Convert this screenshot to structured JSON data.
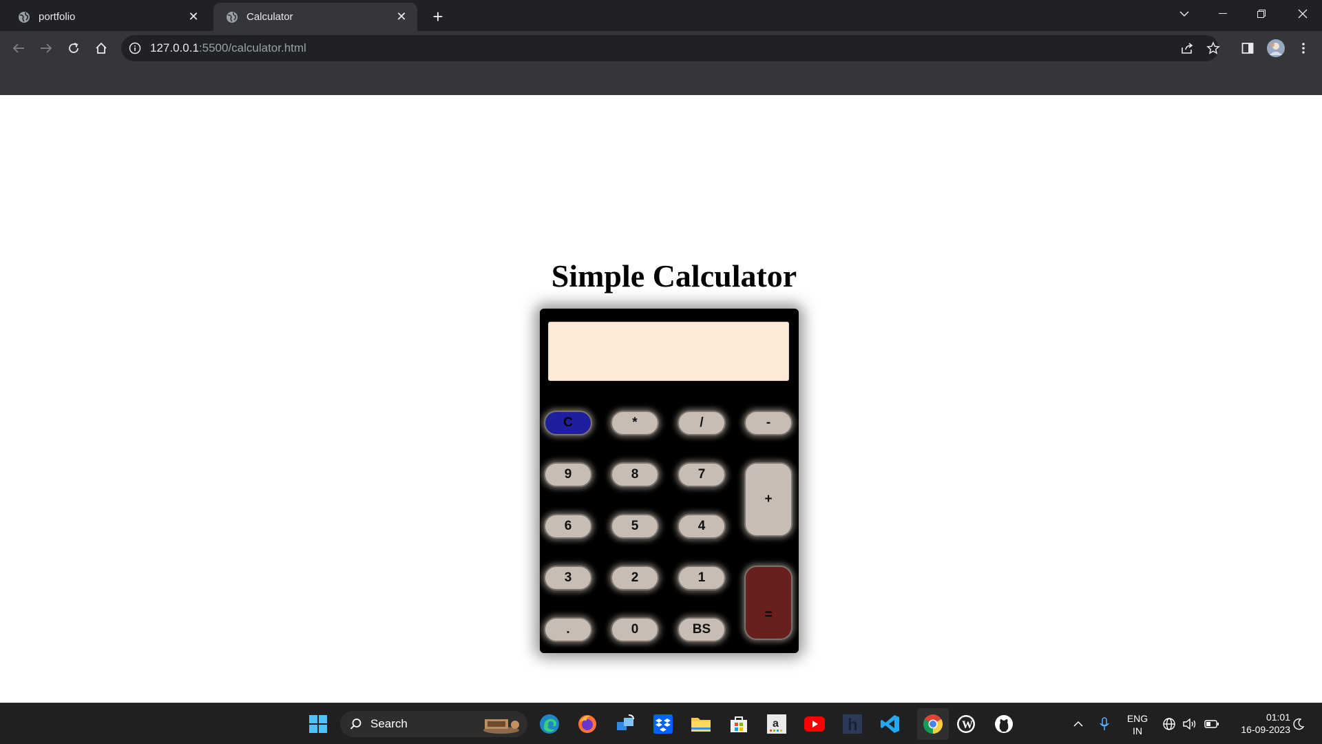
{
  "browser": {
    "tabs": [
      {
        "title": "portfolio",
        "active": false
      },
      {
        "title": "Calculator",
        "active": true
      }
    ],
    "address": {
      "host": "127.0.0.1",
      "path": ":5500/calculator.html"
    }
  },
  "page": {
    "heading": "Simple Calculator",
    "display_value": "",
    "keys": {
      "clear": "C",
      "multiply": "*",
      "divide": "/",
      "minus": "-",
      "nine": "9",
      "eight": "8",
      "seven": "7",
      "plus": "+",
      "six": "6",
      "five": "5",
      "four": "4",
      "three": "3",
      "two": "2",
      "one": "1",
      "equals": "=",
      "dot": ".",
      "zero": "0",
      "backspace": "BS"
    },
    "colors": {
      "display": "#fbead7",
      "key": "#c7bdb4",
      "clear_key": "#1f1f9e",
      "equals_key": "#6a1f1f",
      "calculator_body": "#000000"
    }
  },
  "taskbar": {
    "search_label": "Search",
    "language": "ENG",
    "region": "IN",
    "time": "01:01",
    "date": "16-09-2023"
  }
}
